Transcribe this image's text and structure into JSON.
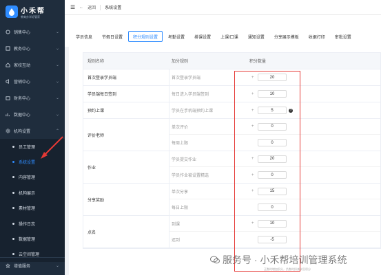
{
  "brand": {
    "title": "小禾帮",
    "subtitle": "教育办学好管家"
  },
  "sidebar": {
    "items": [
      {
        "label": "销售中心",
        "icon": "sales-icon"
      },
      {
        "label": "教务中心",
        "icon": "academic-icon"
      },
      {
        "label": "家校互动",
        "icon": "home-school-icon"
      },
      {
        "label": "营销中心",
        "icon": "marketing-icon"
      },
      {
        "label": "财务中心",
        "icon": "finance-icon"
      },
      {
        "label": "数据中心",
        "icon": "data-icon"
      },
      {
        "label": "机构设置",
        "icon": "org-settings-icon"
      }
    ],
    "submenu": [
      {
        "label": "员工管理"
      },
      {
        "label": "系统设置"
      },
      {
        "label": "内容管理"
      },
      {
        "label": "机构展示"
      },
      {
        "label": "素材管理"
      },
      {
        "label": "操作日志"
      },
      {
        "label": "数据管理"
      },
      {
        "label": "云空间管理"
      }
    ],
    "bottom": {
      "label": "增值服务"
    }
  },
  "topbar": {
    "back": "返回",
    "page_title": "系统设置"
  },
  "tabs": [
    {
      "label": "学员信息"
    },
    {
      "label": "节假日设置"
    },
    {
      "label": "积分规则设置"
    },
    {
      "label": "考勤设置"
    },
    {
      "label": "排课设置"
    },
    {
      "label": "上课/口课"
    },
    {
      "label": "通知设置"
    },
    {
      "label": "分享展示模板"
    },
    {
      "label": "收据打印"
    },
    {
      "label": "审批设置"
    }
  ],
  "table": {
    "headers": {
      "name": "规则名称",
      "rule": "加分规则",
      "points": "积分数量"
    },
    "rows": [
      {
        "name": "首次登录学员端",
        "subs": [
          {
            "rule": "首次登录学员端",
            "sign": "+",
            "value": "20"
          }
        ]
      },
      {
        "name": "学员端每日签到",
        "subs": [
          {
            "rule": "每日进入学员端签到",
            "sign": "+",
            "value": "10"
          }
        ]
      },
      {
        "name": "预约上课",
        "subs": [
          {
            "rule": "学员在手机端预约上课",
            "sign": "+",
            "value": "5",
            "help": "?"
          }
        ]
      },
      {
        "name": "评价老师",
        "subs": [
          {
            "rule": "单次评价",
            "sign": "+",
            "value": "0"
          },
          {
            "rule": "每周上限",
            "sign": "",
            "value": "0"
          }
        ]
      },
      {
        "name": "作业",
        "subs": [
          {
            "rule": "学员提交作业",
            "sign": "+",
            "value": "20"
          },
          {
            "rule": "学员作业被设置精选",
            "sign": "+",
            "value": "0"
          }
        ]
      },
      {
        "name": "分享奖励",
        "subs": [
          {
            "rule": "单次分享",
            "sign": "+",
            "value": "15"
          },
          {
            "rule": "每日上限",
            "sign": "",
            "value": "0"
          }
        ]
      },
      {
        "name": "点名",
        "subs": [
          {
            "rule": "到课",
            "sign": "+",
            "value": "10"
          },
          {
            "rule": "迟到",
            "sign": "",
            "value": "-5"
          }
        ]
      }
    ]
  },
  "watermark": {
    "text": "服务号 · 小禾帮培训管理系统",
    "small": "正数时增加积分，负数时扣减学员积分"
  },
  "colors": {
    "accent": "#2f8cff",
    "sidebar_bg": "#1f2d3d",
    "annotation": "#e53935"
  }
}
